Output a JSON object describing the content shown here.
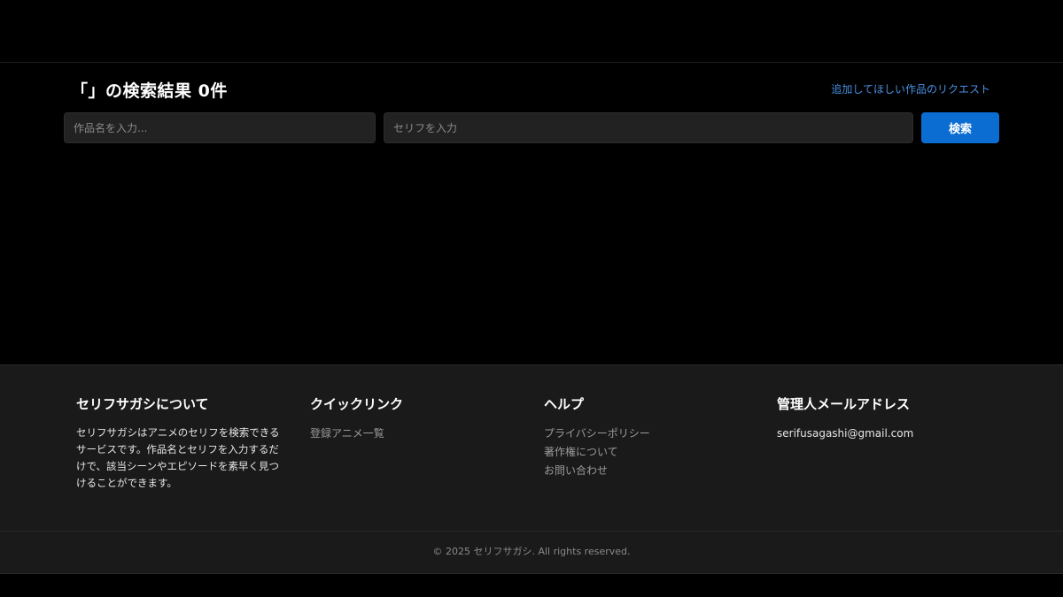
{
  "main": {
    "result_title": "「」の検索結果 0件",
    "request_link": "追加してほしい作品のリクエスト",
    "search": {
      "title_placeholder": "作品名を入力...",
      "line_placeholder": "セリフを入力",
      "button_label": "検索"
    }
  },
  "footer": {
    "about": {
      "heading": "セリフサガシについて",
      "text": "セリフサガシはアニメのセリフを検索できるサービスです。作品名とセリフを入力するだけで、該当シーンやエピソードを素早く見つけることができます。"
    },
    "quick_links": {
      "heading": "クイックリンク",
      "items": [
        "登録アニメ一覧"
      ]
    },
    "help": {
      "heading": "ヘルプ",
      "items": [
        "プライバシーポリシー",
        "著作権について",
        "お問い合わせ"
      ]
    },
    "contact": {
      "heading": "管理人メールアドレス",
      "email": "serifusagashi@gmail.com"
    },
    "copyright": "© 2025 セリフサガシ. All rights reserved."
  },
  "colors": {
    "accent": "#0b6cd1",
    "link": "#4a90e2",
    "background": "#000000",
    "footer_background": "#1a1a1a"
  }
}
